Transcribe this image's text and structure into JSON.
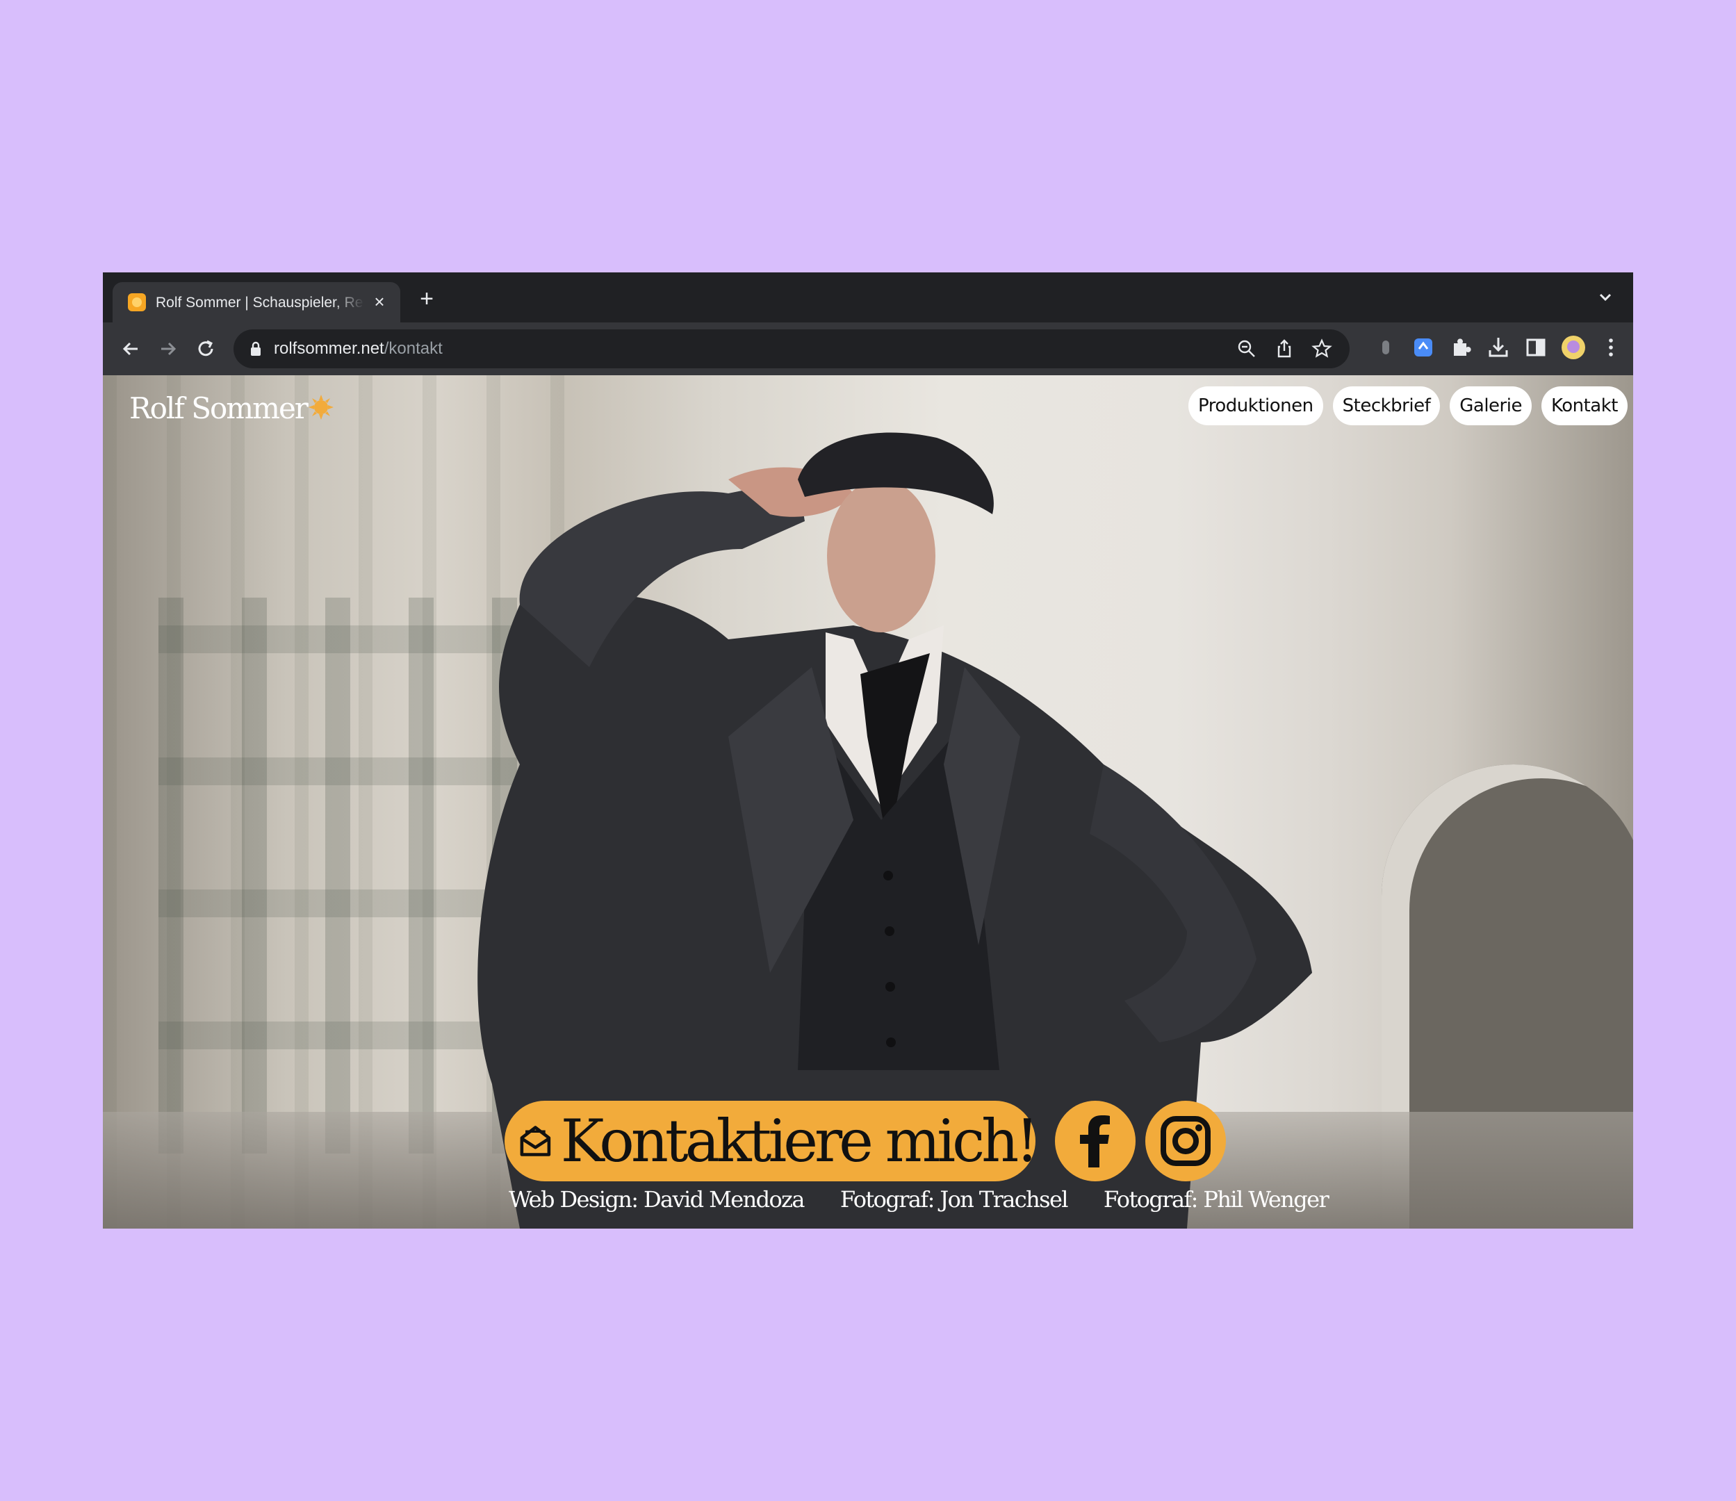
{
  "browser": {
    "tab_title": "Rolf Sommer | Schauspieler, Regisseur",
    "url_host": "rolfsommer.net",
    "url_path": "/kontakt"
  },
  "site": {
    "logo_text": "Rolf Sommer",
    "nav": [
      "Produktionen",
      "Steckbrief",
      "Galerie",
      "Kontakt"
    ],
    "cta_label": "Kontaktiere mich!",
    "credits": [
      "Web Design: David Mendoza",
      "Fotograf: Jon Trachsel",
      "Fotograf: Phil Wenger"
    ]
  },
  "colors": {
    "background": "#d8befc",
    "accent": "#f2ab3b",
    "browser_chrome": "#202124"
  },
  "icons": [
    "back-icon",
    "forward-icon",
    "reload-icon",
    "lock-icon",
    "zoom-icon",
    "share-icon",
    "star-icon",
    "extensions-icon",
    "download-icon",
    "sidepanel-icon",
    "profile-avatar",
    "more-icon",
    "envelope-icon",
    "facebook-icon",
    "instagram-icon",
    "sun-icon"
  ]
}
